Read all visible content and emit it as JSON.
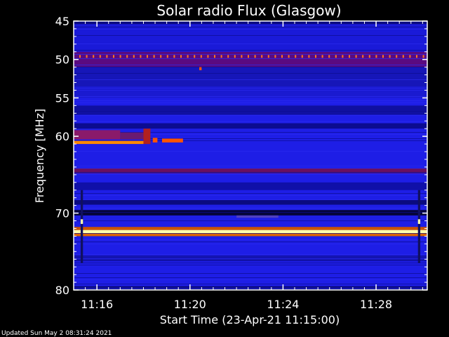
{
  "chart_data": {
    "type": "heatmap",
    "title": "Solar radio Flux (Glasgow)",
    "xlabel": "Start Time (23-Apr-21 11:15:00)",
    "ylabel": "Frequency [MHz]",
    "footer": "Updated Sun May  2 08:31:24 2021",
    "x_unit": "minutes",
    "xlim": [
      15.0,
      30.2
    ],
    "ylim": [
      45,
      80
    ],
    "y_ticks": [
      45,
      50,
      55,
      60,
      70,
      80
    ],
    "y_tick_labels": [
      "45",
      "50",
      "55",
      "60",
      "70",
      "80"
    ],
    "x_ticks": [
      16,
      20,
      24,
      28
    ],
    "x_tick_labels": [
      "11:16",
      "11:20",
      "11:24",
      "11:28"
    ],
    "background_color": "#1e1ee6",
    "bands": [
      {
        "from": 45.0,
        "to": 45.4,
        "color": "#0a0a80"
      },
      {
        "from": 45.4,
        "to": 49.0,
        "color": "#1a1ad8"
      },
      {
        "from": 49.0,
        "to": 51.0,
        "color": "#5a0a80"
      },
      {
        "from": 51.0,
        "to": 53.5,
        "color": "#1616b8"
      },
      {
        "from": 53.5,
        "to": 55.0,
        "color": "#1a1ad0"
      },
      {
        "from": 56.0,
        "to": 57.2,
        "color": "#1010a0"
      },
      {
        "from": 58.3,
        "to": 59.0,
        "color": "#0c0c90"
      },
      {
        "from": 64.2,
        "to": 64.8,
        "color": "#6a1060"
      },
      {
        "from": 66.0,
        "to": 67.0,
        "color": "#1010a8"
      },
      {
        "from": 68.3,
        "to": 68.9,
        "color": "#0a0a80"
      },
      {
        "from": 69.6,
        "to": 70.3,
        "color": "#05053a"
      },
      {
        "from": 71.8,
        "to": 72.2,
        "color": "#cc5500"
      },
      {
        "from": 72.2,
        "to": 72.6,
        "color": "#ffffaa"
      },
      {
        "from": 72.6,
        "to": 73.0,
        "color": "#dd6600"
      },
      {
        "from": 75.5,
        "to": 76.2,
        "color": "#1414b0"
      },
      {
        "from": 79.5,
        "to": 80.0,
        "color": "#0a0a80"
      }
    ],
    "features": [
      {
        "x0": 15.0,
        "x1": 18.0,
        "y0": 60.6,
        "y1": 61.0,
        "color": "#ff8800"
      },
      {
        "x0": 15.0,
        "x1": 17.0,
        "y0": 59.2,
        "y1": 60.4,
        "color": "#8a1a6a"
      },
      {
        "x0": 17.0,
        "x1": 18.0,
        "y0": 59.5,
        "y1": 60.4,
        "color": "#6a1a70"
      },
      {
        "x0": 18.0,
        "x1": 18.3,
        "y0": 59.0,
        "y1": 61.0,
        "color": "#b22020"
      },
      {
        "x0": 18.4,
        "x1": 18.6,
        "y0": 60.2,
        "y1": 60.8,
        "color": "#ff5500"
      },
      {
        "x0": 18.8,
        "x1": 19.7,
        "y0": 60.3,
        "y1": 60.8,
        "color": "#ff5500"
      },
      {
        "x0": 15.3,
        "x1": 15.4,
        "y0": 67.0,
        "y1": 76.5,
        "color": "#101060"
      },
      {
        "x0": 29.8,
        "x1": 29.9,
        "y0": 67.0,
        "y1": 76.5,
        "color": "#101060"
      },
      {
        "x0": 15.3,
        "x1": 15.4,
        "y0": 70.8,
        "y1": 71.4,
        "color": "#ffffaa"
      },
      {
        "x0": 29.8,
        "x1": 29.9,
        "y0": 70.8,
        "y1": 71.4,
        "color": "#ffffaa"
      },
      {
        "x0": 22.0,
        "x1": 23.8,
        "y0": 70.3,
        "y1": 70.6,
        "color": "#5040c0"
      },
      {
        "x0": 20.4,
        "x1": 20.5,
        "y0": 51.0,
        "y1": 51.4,
        "color": "#ff5500"
      }
    ],
    "dotted_line": {
      "freq": 49.6,
      "color": "#ff7722"
    }
  }
}
